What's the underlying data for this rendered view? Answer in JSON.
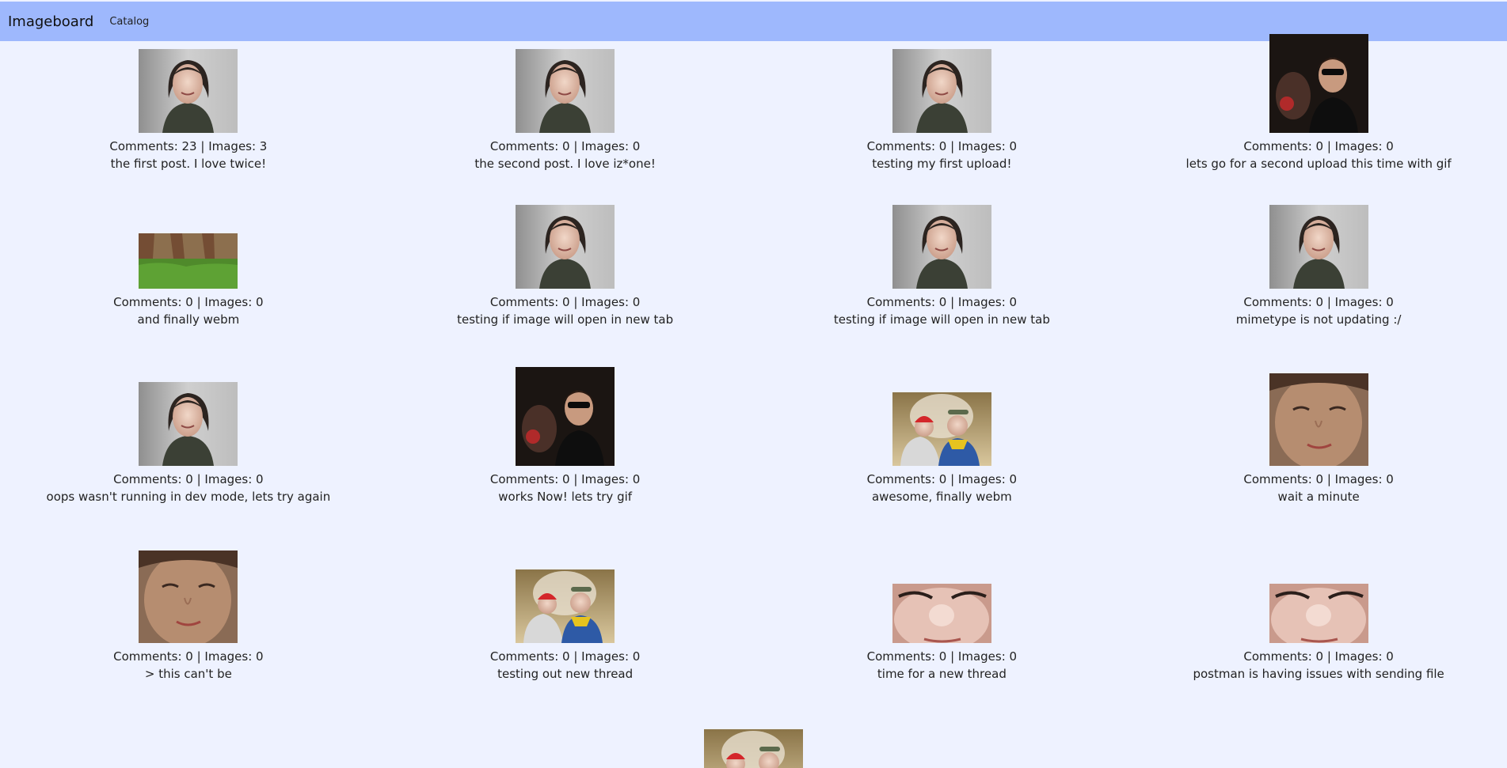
{
  "nav": {
    "brand": "Imageboard",
    "catalog_label": "Catalog"
  },
  "colors": {
    "page_background": "#eef2ff",
    "nav_background": "#9eb8fd"
  },
  "threads": [
    {
      "stats": "Comments: 23 | Images: 3",
      "subject": "the first post. I love twice!",
      "thumb": "woman-portrait"
    },
    {
      "stats": "Comments: 0 | Images: 0",
      "subject": "the second post. I love iz*one!",
      "thumb": "woman-portrait"
    },
    {
      "stats": "Comments: 0 | Images: 0",
      "subject": "testing my first upload!",
      "thumb": "woman-portrait"
    },
    {
      "stats": "Comments: 0 | Images: 0",
      "subject": "lets go for a second upload this time with gif",
      "thumb": "dark-party-scene"
    },
    {
      "stats": "Comments: 0 | Images: 0",
      "subject": "and finally webm",
      "thumb": "grass-wall"
    },
    {
      "stats": "Comments: 0 | Images: 0",
      "subject": "testing if image will open in new tab",
      "thumb": "woman-portrait"
    },
    {
      "stats": "Comments: 0 | Images: 0",
      "subject": "testing if image will open in new tab",
      "thumb": "woman-portrait"
    },
    {
      "stats": "Comments: 0 | Images: 0",
      "subject": "mimetype is not updating :/",
      "thumb": "woman-portrait"
    },
    {
      "stats": "Comments: 0 | Images: 0",
      "subject": "oops wasn't running in dev mode, lets try again",
      "thumb": "woman-portrait"
    },
    {
      "stats": "Comments: 0 | Images: 0",
      "subject": "works Now! lets try gif",
      "thumb": "dark-party-scene"
    },
    {
      "stats": "Comments: 0 | Images: 0",
      "subject": "awesome, finally webm",
      "thumb": "two-people-selfie"
    },
    {
      "stats": "Comments: 0 | Images: 0",
      "subject": "wait a minute",
      "thumb": "face-closeup"
    },
    {
      "stats": "Comments: 0 | Images: 0",
      "subject": "> this can't be",
      "thumb": "face-closeup"
    },
    {
      "stats": "Comments: 0 | Images: 0",
      "subject": "testing out new thread",
      "thumb": "two-people-selfie"
    },
    {
      "stats": "Comments: 0 | Images: 0",
      "subject": "time for a new thread",
      "thumb": "face-zoom"
    },
    {
      "stats": "Comments: 0 | Images: 0",
      "subject": "postman is having issues with sending file",
      "thumb": "face-zoom"
    },
    {
      "thumb": "two-people-selfie"
    }
  ]
}
